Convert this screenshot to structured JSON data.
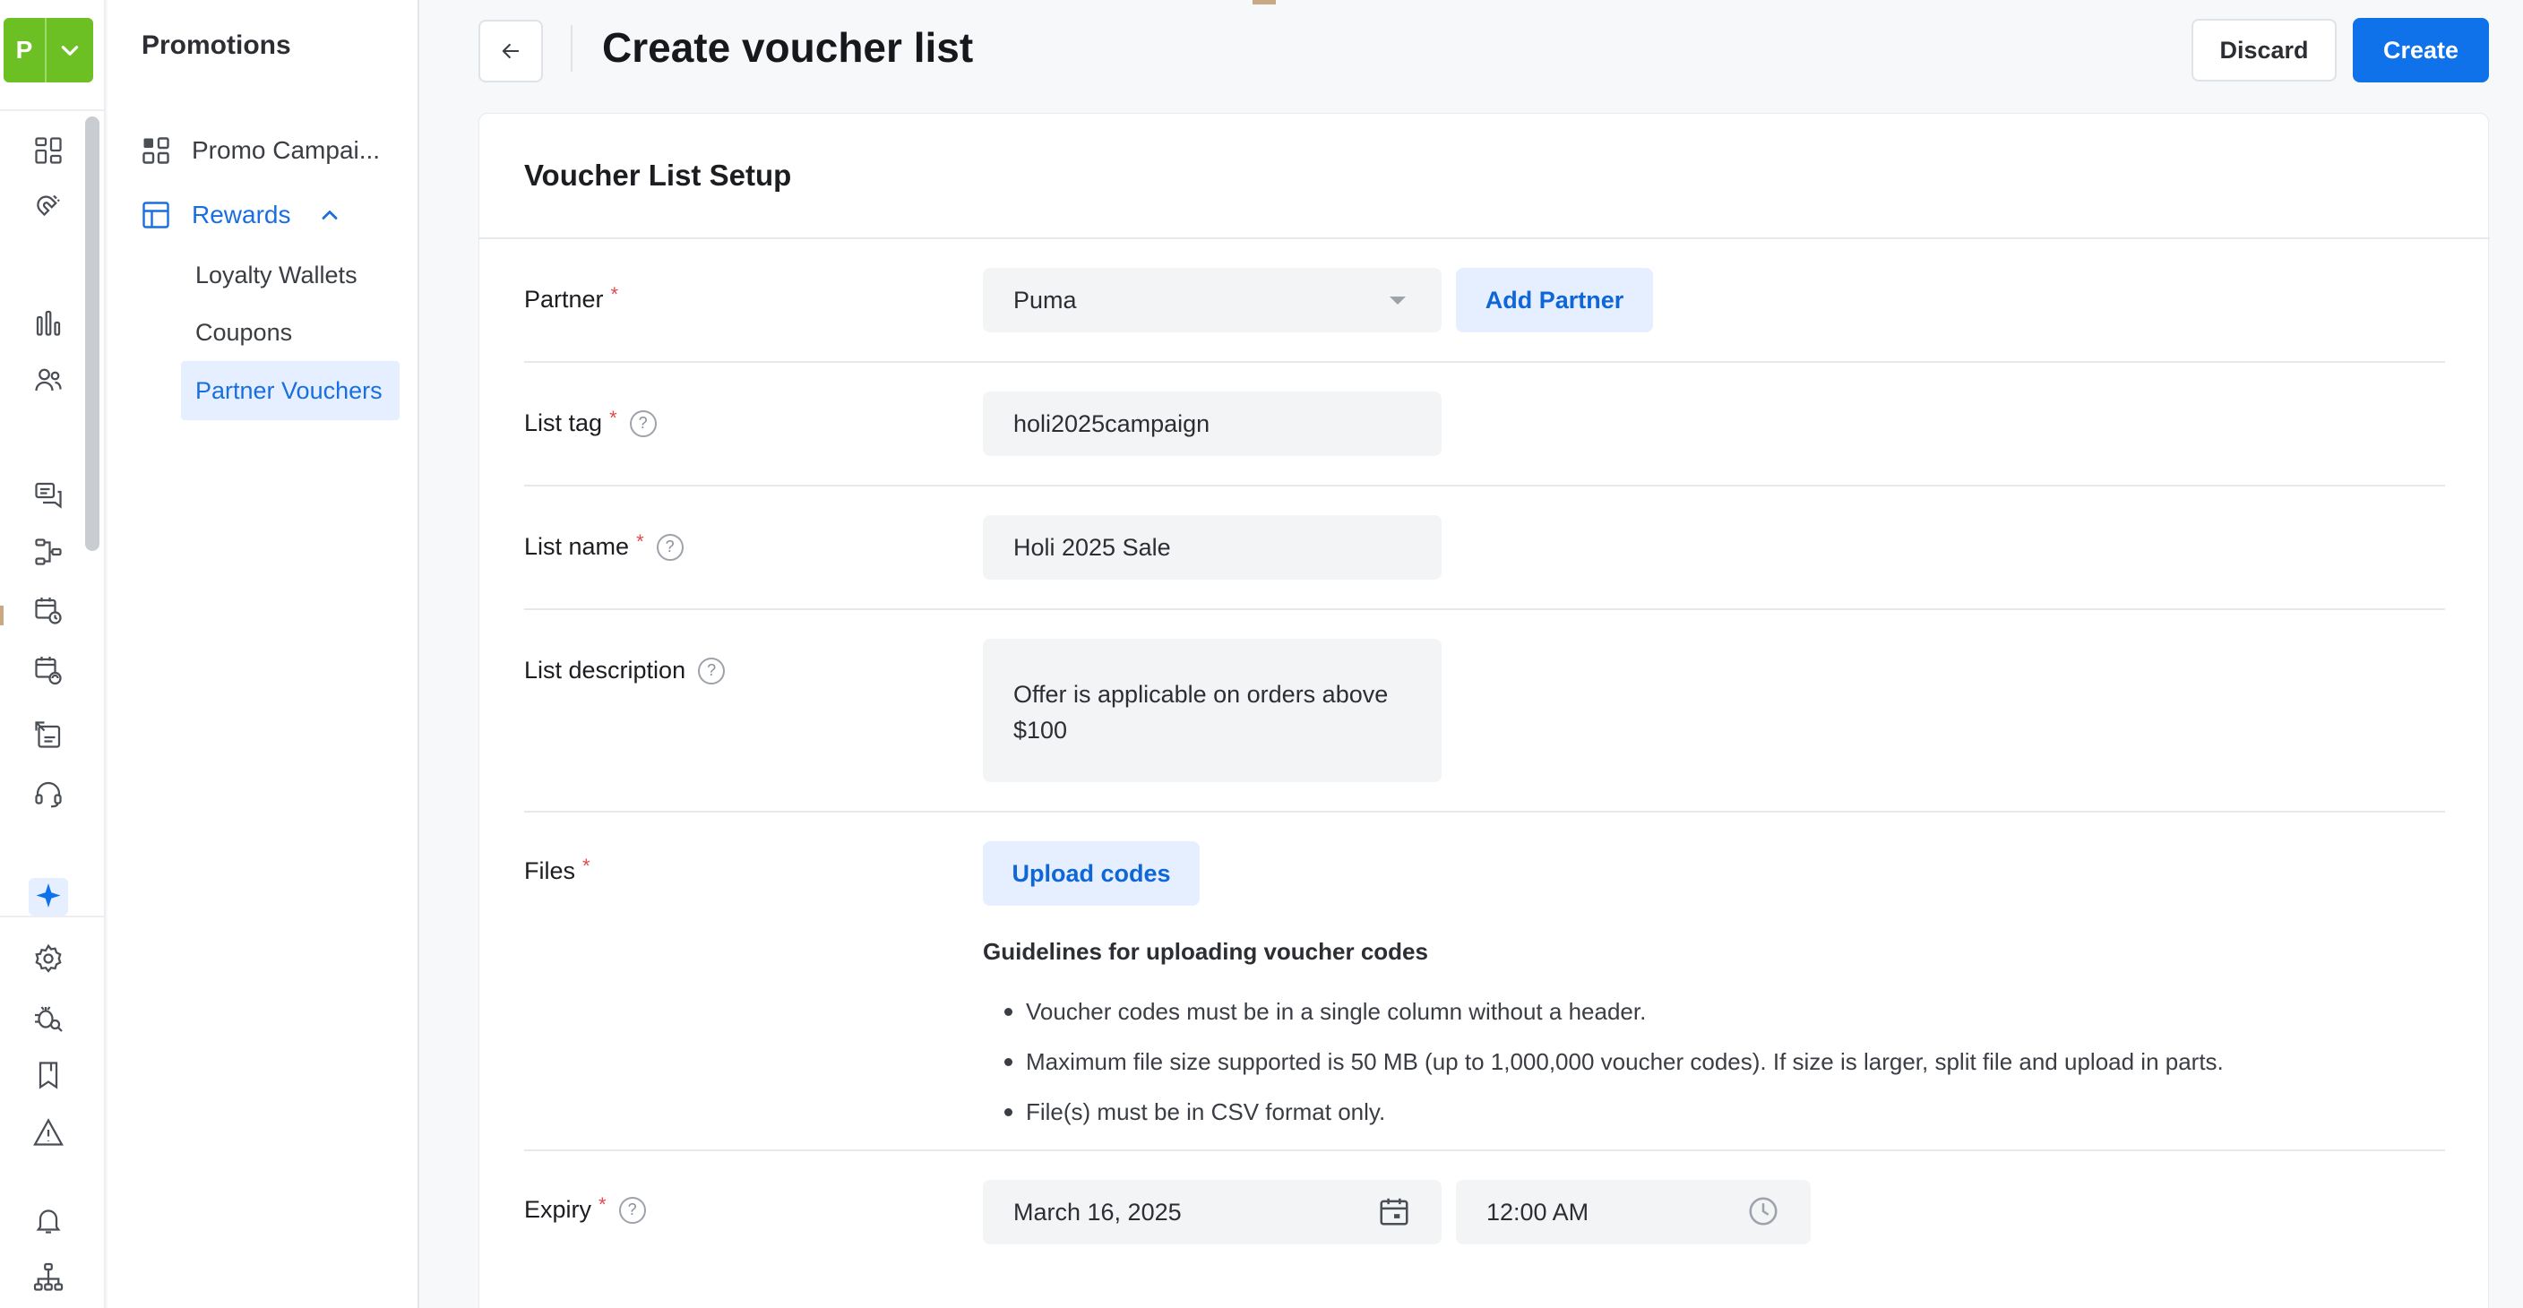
{
  "brand": {
    "letter": "P"
  },
  "subnav": {
    "title": "Promotions",
    "items": [
      {
        "label": "Promo Campai...",
        "icon": "grid-icon"
      },
      {
        "label": "Rewards",
        "icon": "layout-icon",
        "expanded": true
      }
    ],
    "rewards_children": [
      {
        "label": "Loyalty Wallets"
      },
      {
        "label": "Coupons"
      },
      {
        "label": "Partner Vouchers",
        "selected": true
      }
    ]
  },
  "header": {
    "title": "Create voucher list",
    "discard_label": "Discard",
    "create_label": "Create"
  },
  "form": {
    "section_title": "Voucher List Setup",
    "partner": {
      "label": "Partner",
      "value": "Puma",
      "add_label": "Add Partner"
    },
    "list_tag": {
      "label": "List tag",
      "value": "holi2025campaign"
    },
    "list_name": {
      "label": "List name",
      "value": "Holi 2025 Sale"
    },
    "list_description": {
      "label": "List description",
      "value": "Offer is applicable on orders above $100"
    },
    "files": {
      "label": "Files",
      "upload_label": "Upload codes",
      "guidelines_title": "Guidelines for uploading voucher codes",
      "guidelines": [
        "Voucher codes must be in a single column without a header.",
        "Maximum file size supported is 50 MB (up to 1,000,000 voucher codes). If size is larger, split file and upload in parts.",
        "File(s) must be in CSV format only."
      ]
    },
    "expiry": {
      "label": "Expiry",
      "date": "March 16, 2025",
      "time": "12:00 AM"
    }
  },
  "colors": {
    "brand": "#6cc024",
    "primary": "#0f72ea",
    "soft": "#e5efff",
    "required": "#e5484d"
  }
}
